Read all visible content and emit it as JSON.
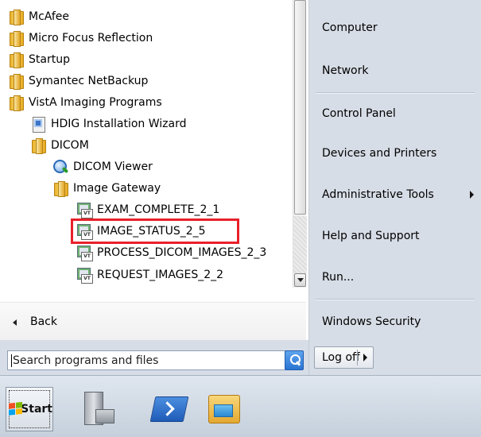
{
  "programs": {
    "items": [
      {
        "label": "McAfee",
        "icon": "folder-icon"
      },
      {
        "label": "Micro Focus Reflection",
        "icon": "folder-icon"
      },
      {
        "label": "Startup",
        "icon": "folder-icon"
      },
      {
        "label": "Symantec NetBackup",
        "icon": "folder-icon"
      },
      {
        "label": "VistA Imaging Programs",
        "icon": "folder-icon"
      },
      {
        "label": "HDIG Installation Wizard",
        "icon": "wizard-icon"
      },
      {
        "label": "DICOM",
        "icon": "folder-icon"
      },
      {
        "label": "DICOM Viewer",
        "icon": "magnifier-icon"
      },
      {
        "label": "Image Gateway",
        "icon": "folder-icon"
      },
      {
        "label": "EXAM_COMPLETE_2_1",
        "icon": "vt-shortcut-icon"
      },
      {
        "label": "IMAGE_STATUS_2_5",
        "icon": "vt-shortcut-icon",
        "highlighted": true
      },
      {
        "label": "PROCESS_DICOM_IMAGES_2_3",
        "icon": "vt-shortcut-icon"
      },
      {
        "label": "REQUEST_IMAGES_2_2",
        "icon": "vt-shortcut-icon"
      }
    ],
    "back_label": "Back"
  },
  "search": {
    "placeholder": "Search programs and files"
  },
  "right_menu": {
    "computer": "Computer",
    "network": "Network",
    "control_panel": "Control Panel",
    "devices_printers": "Devices and Printers",
    "admin_tools": "Administrative Tools",
    "help_support": "Help and Support",
    "run": "Run...",
    "windows_security": "Windows Security",
    "log_off": "Log off"
  },
  "taskbar": {
    "start_label": "Start",
    "pinned": [
      "server-manager-icon",
      "powershell-icon",
      "windows-explorer-icon"
    ]
  },
  "colors": {
    "highlight": "#e8202a",
    "right_pane_bg": "#d7dde6"
  }
}
